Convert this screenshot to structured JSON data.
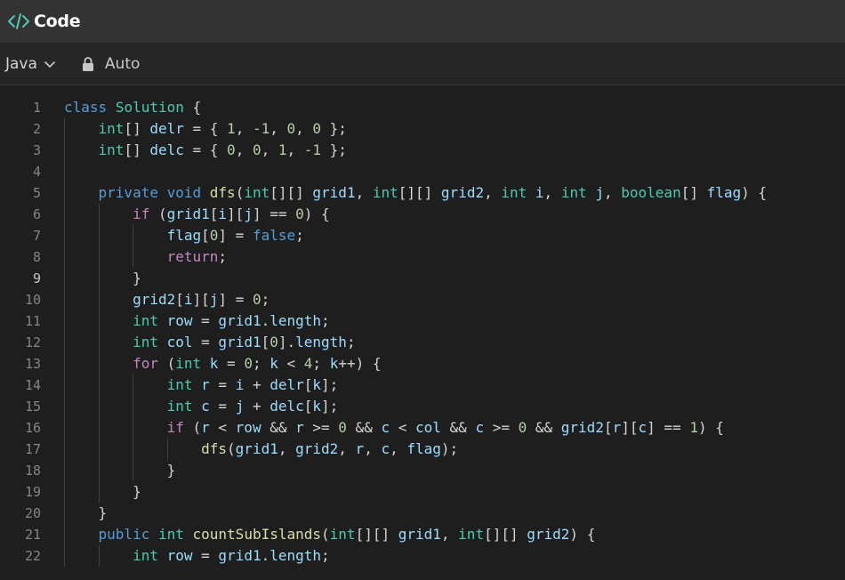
{
  "window": {
    "title": "Code",
    "icon": "code-brackets-icon",
    "accent_color": "#4ec9b0"
  },
  "toolbar": {
    "language": "Java",
    "mode_label": "Auto"
  },
  "editor": {
    "active_line": 9,
    "lines": [
      {
        "n": "1",
        "indent": 0,
        "tokens": [
          [
            "kw",
            "class"
          ],
          [
            "p",
            " "
          ],
          [
            "type",
            "Solution"
          ],
          [
            "p",
            " {"
          ]
        ]
      },
      {
        "n": "2",
        "indent": 1,
        "tokens": [
          [
            "type",
            "int"
          ],
          [
            "p",
            "[] "
          ],
          [
            "var",
            "delr"
          ],
          [
            "p",
            " = { "
          ],
          [
            "num",
            "1"
          ],
          [
            "p",
            ", "
          ],
          [
            "num",
            "-1"
          ],
          [
            "p",
            ", "
          ],
          [
            "num",
            "0"
          ],
          [
            "p",
            ", "
          ],
          [
            "num",
            "0"
          ],
          [
            "p",
            " };"
          ]
        ]
      },
      {
        "n": "3",
        "indent": 1,
        "tokens": [
          [
            "type",
            "int"
          ],
          [
            "p",
            "[] "
          ],
          [
            "var",
            "delc"
          ],
          [
            "p",
            " = { "
          ],
          [
            "num",
            "0"
          ],
          [
            "p",
            ", "
          ],
          [
            "num",
            "0"
          ],
          [
            "p",
            ", "
          ],
          [
            "num",
            "1"
          ],
          [
            "p",
            ", "
          ],
          [
            "num",
            "-1"
          ],
          [
            "p",
            " };"
          ]
        ]
      },
      {
        "n": "4",
        "indent": 1,
        "tokens": []
      },
      {
        "n": "5",
        "indent": 1,
        "tokens": [
          [
            "kw",
            "private"
          ],
          [
            "p",
            " "
          ],
          [
            "kw",
            "void"
          ],
          [
            "p",
            " "
          ],
          [
            "fn",
            "dfs"
          ],
          [
            "p",
            "("
          ],
          [
            "type",
            "int"
          ],
          [
            "p",
            "[][] "
          ],
          [
            "var",
            "grid1"
          ],
          [
            "p",
            ", "
          ],
          [
            "type",
            "int"
          ],
          [
            "p",
            "[][] "
          ],
          [
            "var",
            "grid2"
          ],
          [
            "p",
            ", "
          ],
          [
            "type",
            "int"
          ],
          [
            "p",
            " "
          ],
          [
            "var",
            "i"
          ],
          [
            "p",
            ", "
          ],
          [
            "type",
            "int"
          ],
          [
            "p",
            " "
          ],
          [
            "var",
            "j"
          ],
          [
            "p",
            ", "
          ],
          [
            "type",
            "boolean"
          ],
          [
            "p",
            "[] "
          ],
          [
            "var",
            "flag"
          ],
          [
            "p",
            ") {"
          ]
        ]
      },
      {
        "n": "6",
        "indent": 2,
        "tokens": [
          [
            "ctl",
            "if"
          ],
          [
            "p",
            " ("
          ],
          [
            "var",
            "grid1"
          ],
          [
            "p",
            "["
          ],
          [
            "var",
            "i"
          ],
          [
            "p",
            "]["
          ],
          [
            "var",
            "j"
          ],
          [
            "p",
            "] == "
          ],
          [
            "num",
            "0"
          ],
          [
            "p",
            ") {"
          ]
        ]
      },
      {
        "n": "7",
        "indent": 3,
        "tokens": [
          [
            "var",
            "flag"
          ],
          [
            "p",
            "["
          ],
          [
            "num",
            "0"
          ],
          [
            "p",
            "] = "
          ],
          [
            "kw",
            "false"
          ],
          [
            "p",
            ";"
          ]
        ]
      },
      {
        "n": "8",
        "indent": 3,
        "tokens": [
          [
            "ctl",
            "return"
          ],
          [
            "p",
            ";"
          ]
        ]
      },
      {
        "n": "9",
        "indent": 2,
        "tokens": [
          [
            "p",
            "}"
          ]
        ]
      },
      {
        "n": "10",
        "indent": 2,
        "tokens": [
          [
            "var",
            "grid2"
          ],
          [
            "p",
            "["
          ],
          [
            "var",
            "i"
          ],
          [
            "p",
            "]["
          ],
          [
            "var",
            "j"
          ],
          [
            "p",
            "] = "
          ],
          [
            "num",
            "0"
          ],
          [
            "p",
            ";"
          ]
        ]
      },
      {
        "n": "11",
        "indent": 2,
        "tokens": [
          [
            "type",
            "int"
          ],
          [
            "p",
            " "
          ],
          [
            "var",
            "row"
          ],
          [
            "p",
            " = "
          ],
          [
            "var",
            "grid1"
          ],
          [
            "p",
            "."
          ],
          [
            "var",
            "length"
          ],
          [
            "p",
            ";"
          ]
        ]
      },
      {
        "n": "12",
        "indent": 2,
        "tokens": [
          [
            "type",
            "int"
          ],
          [
            "p",
            " "
          ],
          [
            "var",
            "col"
          ],
          [
            "p",
            " = "
          ],
          [
            "var",
            "grid1"
          ],
          [
            "p",
            "["
          ],
          [
            "num",
            "0"
          ],
          [
            "p",
            "]."
          ],
          [
            "var",
            "length"
          ],
          [
            "p",
            ";"
          ]
        ]
      },
      {
        "n": "13",
        "indent": 2,
        "tokens": [
          [
            "ctl",
            "for"
          ],
          [
            "p",
            " ("
          ],
          [
            "type",
            "int"
          ],
          [
            "p",
            " "
          ],
          [
            "var",
            "k"
          ],
          [
            "p",
            " = "
          ],
          [
            "num",
            "0"
          ],
          [
            "p",
            "; "
          ],
          [
            "var",
            "k"
          ],
          [
            "p",
            " < "
          ],
          [
            "num",
            "4"
          ],
          [
            "p",
            "; "
          ],
          [
            "var",
            "k"
          ],
          [
            "p",
            "++) {"
          ]
        ]
      },
      {
        "n": "14",
        "indent": 3,
        "tokens": [
          [
            "type",
            "int"
          ],
          [
            "p",
            " "
          ],
          [
            "var",
            "r"
          ],
          [
            "p",
            " = "
          ],
          [
            "var",
            "i"
          ],
          [
            "p",
            " + "
          ],
          [
            "var",
            "delr"
          ],
          [
            "p",
            "["
          ],
          [
            "var",
            "k"
          ],
          [
            "p",
            "];"
          ]
        ]
      },
      {
        "n": "15",
        "indent": 3,
        "tokens": [
          [
            "type",
            "int"
          ],
          [
            "p",
            " "
          ],
          [
            "var",
            "c"
          ],
          [
            "p",
            " = "
          ],
          [
            "var",
            "j"
          ],
          [
            "p",
            " + "
          ],
          [
            "var",
            "delc"
          ],
          [
            "p",
            "["
          ],
          [
            "var",
            "k"
          ],
          [
            "p",
            "];"
          ]
        ]
      },
      {
        "n": "16",
        "indent": 3,
        "tokens": [
          [
            "ctl",
            "if"
          ],
          [
            "p",
            " ("
          ],
          [
            "var",
            "r"
          ],
          [
            "p",
            " < "
          ],
          [
            "var",
            "row"
          ],
          [
            "p",
            " && "
          ],
          [
            "var",
            "r"
          ],
          [
            "p",
            " >= "
          ],
          [
            "num",
            "0"
          ],
          [
            "p",
            " && "
          ],
          [
            "var",
            "c"
          ],
          [
            "p",
            " < "
          ],
          [
            "var",
            "col"
          ],
          [
            "p",
            " && "
          ],
          [
            "var",
            "c"
          ],
          [
            "p",
            " >= "
          ],
          [
            "num",
            "0"
          ],
          [
            "p",
            " && "
          ],
          [
            "var",
            "grid2"
          ],
          [
            "p",
            "["
          ],
          [
            "var",
            "r"
          ],
          [
            "p",
            "]["
          ],
          [
            "var",
            "c"
          ],
          [
            "p",
            "] == "
          ],
          [
            "num",
            "1"
          ],
          [
            "p",
            ") {"
          ]
        ]
      },
      {
        "n": "17",
        "indent": 4,
        "tokens": [
          [
            "fn",
            "dfs"
          ],
          [
            "p",
            "("
          ],
          [
            "var",
            "grid1"
          ],
          [
            "p",
            ", "
          ],
          [
            "var",
            "grid2"
          ],
          [
            "p",
            ", "
          ],
          [
            "var",
            "r"
          ],
          [
            "p",
            ", "
          ],
          [
            "var",
            "c"
          ],
          [
            "p",
            ", "
          ],
          [
            "var",
            "flag"
          ],
          [
            "p",
            ");"
          ]
        ]
      },
      {
        "n": "18",
        "indent": 3,
        "tokens": [
          [
            "p",
            "}"
          ]
        ]
      },
      {
        "n": "19",
        "indent": 2,
        "tokens": [
          [
            "p",
            "}"
          ]
        ]
      },
      {
        "n": "20",
        "indent": 1,
        "tokens": [
          [
            "p",
            "}"
          ]
        ]
      },
      {
        "n": "21",
        "indent": 1,
        "tokens": [
          [
            "kw",
            "public"
          ],
          [
            "p",
            " "
          ],
          [
            "type",
            "int"
          ],
          [
            "p",
            " "
          ],
          [
            "fn",
            "countSubIslands"
          ],
          [
            "p",
            "("
          ],
          [
            "type",
            "int"
          ],
          [
            "p",
            "[][] "
          ],
          [
            "var",
            "grid1"
          ],
          [
            "p",
            ", "
          ],
          [
            "type",
            "int"
          ],
          [
            "p",
            "[][] "
          ],
          [
            "var",
            "grid2"
          ],
          [
            "p",
            ") {"
          ]
        ]
      },
      {
        "n": "22",
        "indent": 2,
        "tokens": [
          [
            "type",
            "int"
          ],
          [
            "p",
            " "
          ],
          [
            "var",
            "row"
          ],
          [
            "p",
            " = "
          ],
          [
            "var",
            "grid1"
          ],
          [
            "p",
            "."
          ],
          [
            "var",
            "length"
          ],
          [
            "p",
            ";"
          ]
        ]
      }
    ]
  }
}
